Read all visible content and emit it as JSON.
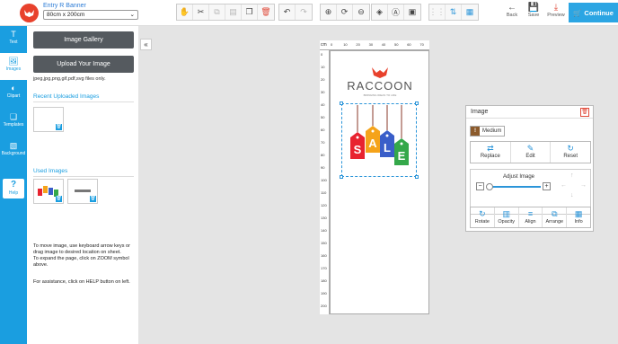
{
  "project": {
    "title": "Entry R Banner",
    "size": "80cm x 200cm"
  },
  "toolbar_actions": {
    "back": "Back",
    "save": "Save",
    "preview": "Preview",
    "continue": "Continue"
  },
  "sidebar": [
    {
      "label": "Text",
      "icon": "text-icon"
    },
    {
      "label": "Images",
      "icon": "images-icon"
    },
    {
      "label": "Clipart",
      "icon": "clipart-icon"
    },
    {
      "label": "Templates",
      "icon": "templates-icon"
    },
    {
      "label": "Background",
      "icon": "background-icon"
    }
  ],
  "help_label": "Help",
  "panel": {
    "gallery_button": "Image Gallery",
    "upload_button": "Upload Your Image",
    "file_types": "jpeg,jpg,png,gif,pdf,svg files only.",
    "recent_title": "Recent Uploaded Images",
    "used_title": "Used Images",
    "instructions_1": "To move image, use keyboard arrow keys or drag image to desired location on sheet.",
    "instructions_2": "To expand the page, click on ZOOM symbol above.",
    "instructions_3": "For assistance, click on HELP button on left."
  },
  "ruler": {
    "unit": "cm",
    "h_ticks": [
      "0",
      "10",
      "20",
      "30",
      "40",
      "50",
      "60",
      "70"
    ],
    "v_ticks": [
      "0",
      "10",
      "20",
      "30",
      "40",
      "50",
      "60",
      "70",
      "80",
      "90",
      "100",
      "110",
      "120",
      "130",
      "140",
      "150",
      "160",
      "170",
      "180",
      "190",
      "200"
    ]
  },
  "design": {
    "brand": "RACCOON",
    "tagline": "BRINGING IDEAS TO LIFE",
    "sale_letters": [
      "S",
      "A",
      "L",
      "E"
    ],
    "tag_colors": [
      "#e8232f",
      "#f5a31a",
      "#3a5ec9",
      "#34a84a"
    ]
  },
  "image_panel": {
    "title": "Image",
    "quality": "Medium",
    "actions": [
      "Replace",
      "Edit",
      "Reset"
    ],
    "adjust_label": "Adjust Image",
    "tools": [
      "Rotate",
      "Opacity",
      "Align",
      "Arrange",
      "Info"
    ]
  },
  "colors": {
    "accent": "#1a9ee0",
    "danger": "#e04a3a",
    "button_dark": "#555a5f"
  }
}
